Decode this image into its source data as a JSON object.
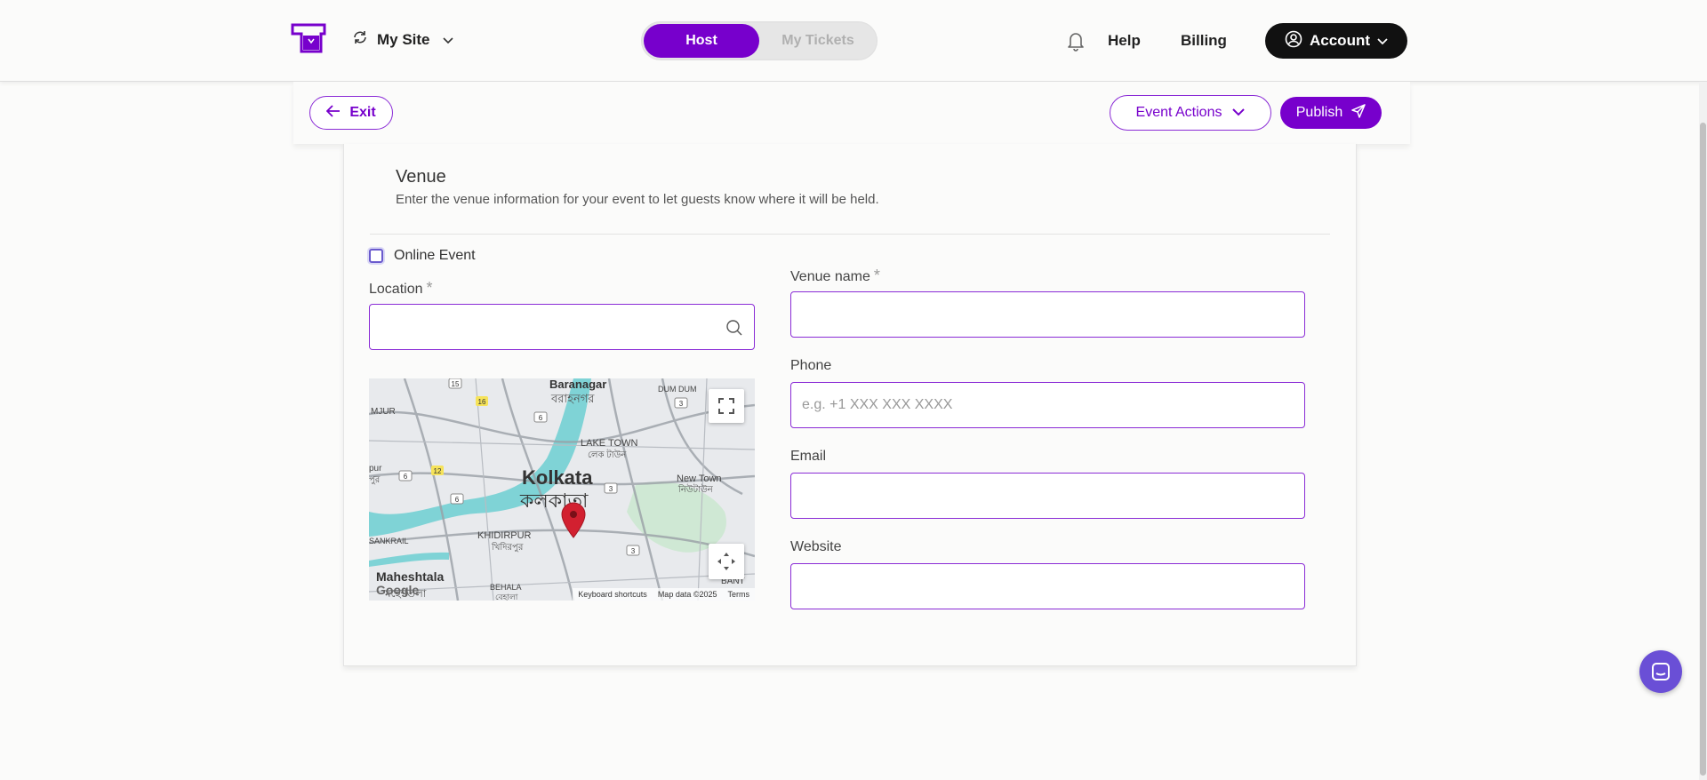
{
  "header": {
    "site_name": "My Site",
    "toggle_active": "Host",
    "toggle_inactive": "My Tickets",
    "help_label": "Help",
    "billing_label": "Billing",
    "account_label": "Account"
  },
  "actions": {
    "exit_label": "Exit",
    "event_actions_label": "Event Actions",
    "publish_label": "Publish"
  },
  "venue": {
    "title": "Venue",
    "description": "Enter the venue information for your event to let guests know where it will be held.",
    "online_event_label": "Online Event",
    "location_label": "Location",
    "venue_name_label": "Venue name",
    "phone_label": "Phone",
    "phone_placeholder": "e.g. +1 XXX XXX XXXX",
    "email_label": "Email",
    "website_label": "Website",
    "required_mark": "*"
  },
  "map": {
    "labels": {
      "baranagar": "Baranagar",
      "baranagar_bn": "বরাহনগর",
      "dum_dum": "DUM DUM",
      "lake_town": "LAKE TOWN",
      "lake_town_bn": "লেক টাউন",
      "kolkata": "Kolkata",
      "kolkata_bn": "কলকাতা",
      "new_town": "New Town",
      "new_town_bn": "নিউটাউন",
      "mjur": "MJUR",
      "pur": "pur",
      "pur_bn": "পুর",
      "sankrail": "SANKRAIL",
      "khidirpur": "KHIDIRPUR",
      "khidirpur_bn": "খিদিরপুর",
      "maheshtala": "Maheshtala",
      "maheshtala_bn": "মহেশতলা",
      "behala": "BEHALA",
      "behala_bn": "বেহালা",
      "bant": "BANT"
    },
    "road_numbers": [
      "15",
      "16",
      "6",
      "3",
      "12",
      "6",
      "6",
      "3",
      "3"
    ],
    "attribution": {
      "google": "Google",
      "keyboard": "Keyboard shortcuts",
      "map_data": "Map data ©2025",
      "terms": "Terms"
    }
  },
  "colors": {
    "accent": "#7700cc",
    "dark": "#111111",
    "chat": "#6a4fd6"
  }
}
